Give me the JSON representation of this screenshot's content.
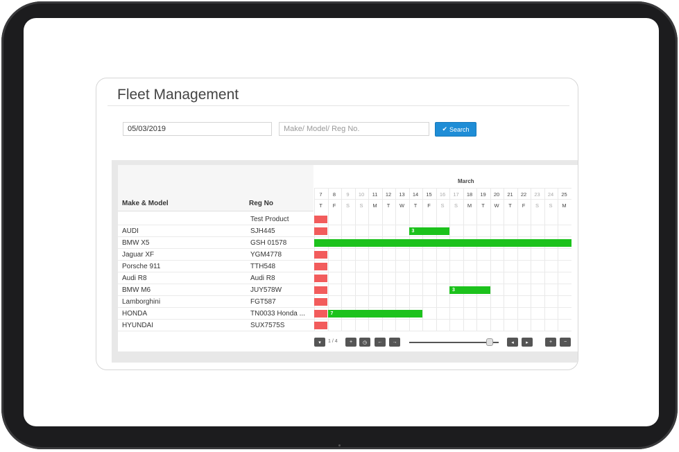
{
  "app": {
    "title": "Fleet Management"
  },
  "filters": {
    "date_value": "05/03/2019",
    "search_placeholder": "Make/ Model/ Reg No.",
    "search_label": "Search"
  },
  "gantt": {
    "columns": {
      "make_model": "Make & Model",
      "reg_no": "Reg No"
    },
    "month": "March",
    "days": [
      {
        "num": "7",
        "dow": "T",
        "weekend": false
      },
      {
        "num": "8",
        "dow": "F",
        "weekend": false
      },
      {
        "num": "9",
        "dow": "S",
        "weekend": true
      },
      {
        "num": "10",
        "dow": "S",
        "weekend": true
      },
      {
        "num": "11",
        "dow": "M",
        "weekend": false
      },
      {
        "num": "12",
        "dow": "T",
        "weekend": false
      },
      {
        "num": "13",
        "dow": "W",
        "weekend": false
      },
      {
        "num": "14",
        "dow": "T",
        "weekend": false
      },
      {
        "num": "15",
        "dow": "F",
        "weekend": false
      },
      {
        "num": "16",
        "dow": "S",
        "weekend": true
      },
      {
        "num": "17",
        "dow": "S",
        "weekend": true
      },
      {
        "num": "18",
        "dow": "M",
        "weekend": false
      },
      {
        "num": "19",
        "dow": "T",
        "weekend": false
      },
      {
        "num": "20",
        "dow": "W",
        "weekend": false
      },
      {
        "num": "21",
        "dow": "T",
        "weekend": false
      },
      {
        "num": "22",
        "dow": "F",
        "weekend": false
      },
      {
        "num": "23",
        "dow": "S",
        "weekend": true
      },
      {
        "num": "24",
        "dow": "S",
        "weekend": true
      },
      {
        "num": "25",
        "dow": "M",
        "weekend": false
      }
    ],
    "rows": [
      {
        "make": "",
        "reg": "Test Product",
        "today": true,
        "bar": null
      },
      {
        "make": "AUDI",
        "reg": "SJH445",
        "today": true,
        "bar": {
          "start": 7,
          "span": 3,
          "label": "3"
        }
      },
      {
        "make": "BMW X5",
        "reg": "GSH 01578",
        "today": false,
        "bar": {
          "start": 0,
          "span": 19,
          "label": ""
        }
      },
      {
        "make": "Jaguar XF",
        "reg": "YGM4778",
        "today": true,
        "bar": null
      },
      {
        "make": "Porsche 911",
        "reg": "TTH548",
        "today": true,
        "bar": null
      },
      {
        "make": "Audi R8",
        "reg": "Audi R8",
        "today": true,
        "bar": null
      },
      {
        "make": "BMW M6",
        "reg": "JUY578W",
        "today": true,
        "bar": {
          "start": 10,
          "span": 3,
          "label": "3"
        }
      },
      {
        "make": "Lamborghini",
        "reg": "FGT587",
        "today": true,
        "bar": null
      },
      {
        "make": "HONDA",
        "reg": "TN0033 Honda ...",
        "today": true,
        "bar": {
          "start": 1,
          "span": 7,
          "label": "7"
        }
      },
      {
        "make": "HYUNDAI",
        "reg": "SUX7575S",
        "today": true,
        "bar": null
      }
    ],
    "pager": {
      "text": "1 / 4"
    },
    "zoom_level": 0.92,
    "colors": {
      "booked": "#1cc21c",
      "today": "#f25c5c"
    }
  },
  "toolbar": {
    "icons": [
      "chevron-down-icon",
      "plus-small-icon",
      "clock-icon",
      "arrow-left-icon",
      "arrow-right-icon",
      "zoom-slider",
      "step-back-icon",
      "step-forward-icon",
      "zoom-in-icon",
      "zoom-out-icon"
    ]
  }
}
